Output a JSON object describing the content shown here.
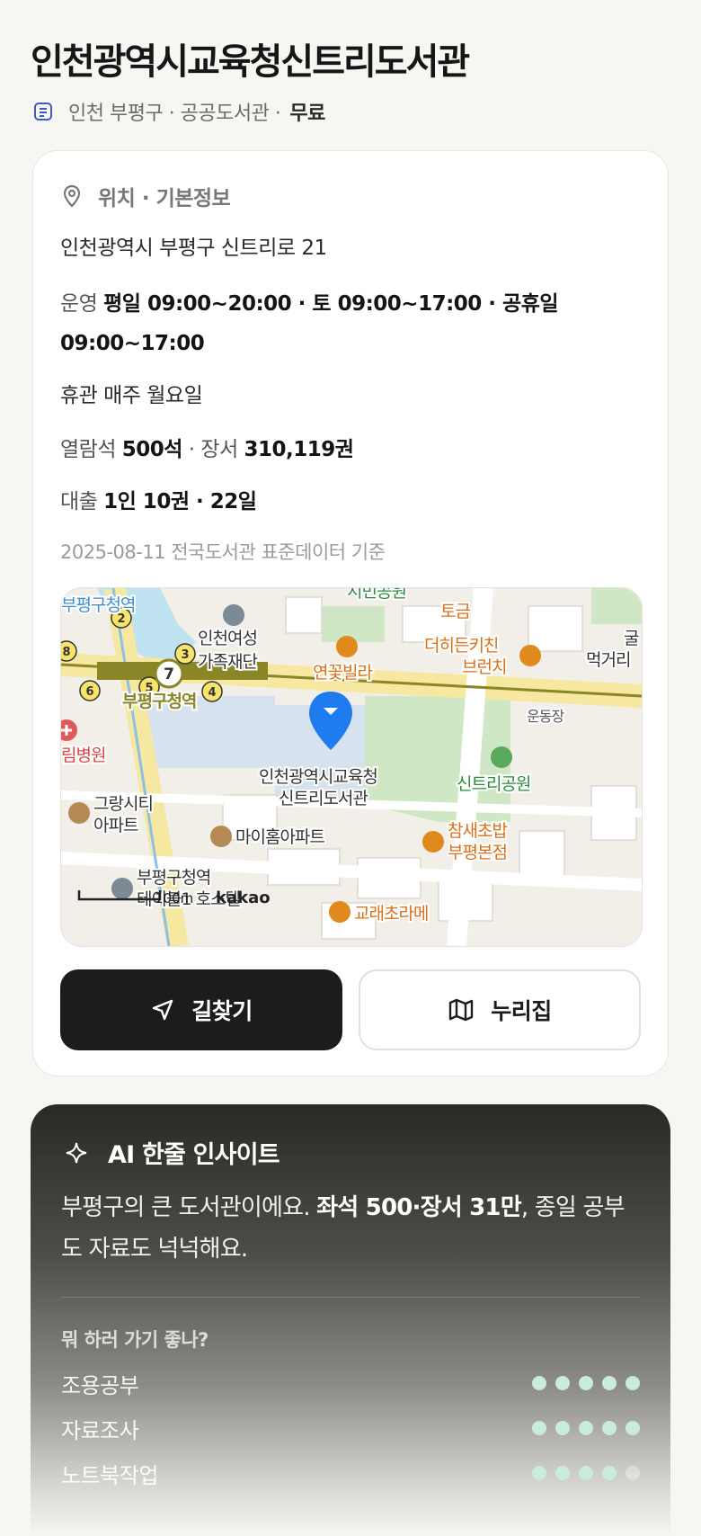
{
  "library": {
    "name": "인천광역시교육청신트리도서관",
    "region": "인천 부평구 · 공공도서관 ·",
    "fee": "무료"
  },
  "info": {
    "section_title": "위치 · 기본정보",
    "address": "인천광역시 부평구 신트리로 21",
    "hours_label": "운영",
    "hours_value": "평일 09:00~20:00 · 토 09:00~17:00 · 공휴일 09:00~17:00",
    "closed": "휴관 매주 월요일",
    "seats_label": "열람석",
    "seats_value": "500석",
    "books_label": "· 장서",
    "books_value": "310,119권",
    "loan_label": "대출",
    "loan_value": "1인 10권 · 22일",
    "source": "2025-08-11 전국도서관 표준데이터 기준"
  },
  "map": {
    "labels": {
      "station_top": "부평구청역",
      "station_mid": "부평구청역",
      "hospital": "림병원",
      "foundation_1": "인천여성",
      "foundation_2": "가족재단",
      "villa": "연꽃빌라",
      "togeum": "토금",
      "kitchen_1": "더히든키친",
      "kitchen_2": "브런치",
      "eat": "먹거리",
      "gul": "굴",
      "playground": "운동장",
      "park": "신트리공원",
      "target_1": "인천광역시교육청",
      "target_2": "신트리도서관",
      "apt_grang_1": "그랑시티",
      "apt_grang_2": "아파트",
      "apt_myhome": "마이홈아파트",
      "rest_1": "참새초밥",
      "rest_2": "부평본점",
      "station_bottom": "부평구청역",
      "hostel": "테이블1 호스텔",
      "cafe_bottom": "교래초라메",
      "park_top": "시민공원",
      "scale": "100m",
      "brand": "kakao"
    },
    "exits": [
      "2",
      "3",
      "4",
      "5",
      "6",
      "7",
      "8"
    ],
    "colors": {
      "pin": "#1f7cf0",
      "subway": "#8a8526",
      "park": "#cfe7c4",
      "water": "#bfe3f0"
    }
  },
  "buttons": {
    "directions": "길찾기",
    "website": "누리집"
  },
  "ai": {
    "title": "AI 한줄 인사이트",
    "text_a": "부평구의 큰 도서관이에요. ",
    "text_bold": "좌석 500·장서 31만",
    "text_b": ", 종일 공부도 자료도 넉넉해요.",
    "question": "뭐 하러 가기 좋나?",
    "ratings": [
      {
        "name": "조용공부",
        "score": 5
      },
      {
        "name": "자료조사",
        "score": 5
      },
      {
        "name": "노트북작업",
        "score": 4
      }
    ]
  }
}
